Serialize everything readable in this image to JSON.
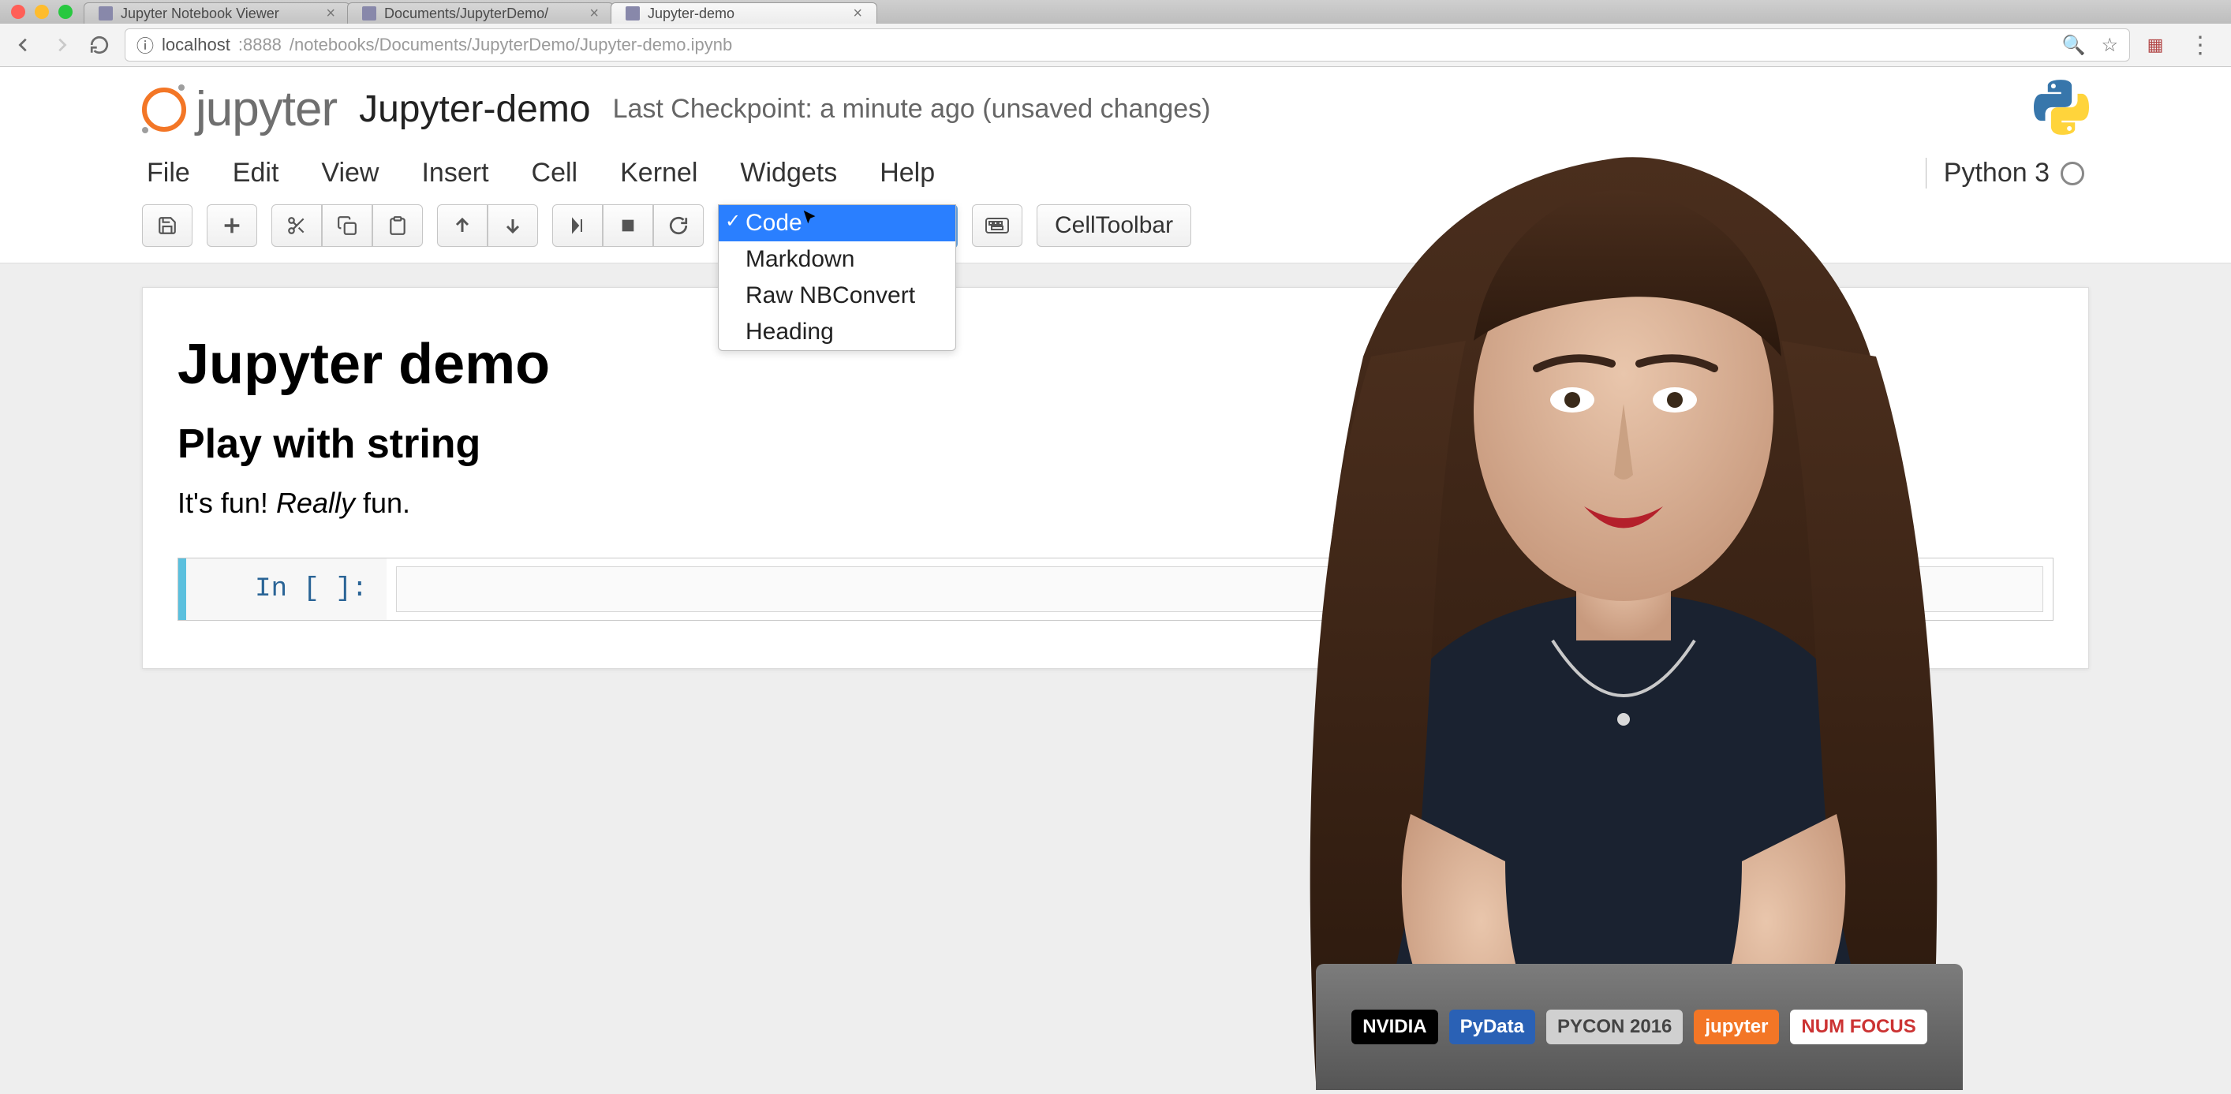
{
  "browser": {
    "tabs": [
      {
        "label": "Jupyter Notebook Viewer"
      },
      {
        "label": "Documents/JupyterDemo/"
      },
      {
        "label": "Jupyter-demo"
      }
    ],
    "url_host": "localhost",
    "url_port": ":8888",
    "url_path": "/notebooks/Documents/JupyterDemo/Jupyter-demo.ipynb"
  },
  "header": {
    "logo_text": "jupyter",
    "notebook_name": "Jupyter-demo",
    "checkpoint": "Last Checkpoint: a minute ago (unsaved changes)"
  },
  "menu": {
    "items": [
      "File",
      "Edit",
      "View",
      "Insert",
      "Cell",
      "Kernel",
      "Widgets",
      "Help"
    ],
    "kernel": "Python 3"
  },
  "toolbar": {
    "celltype_options": [
      "Code",
      "Markdown",
      "Raw NBConvert",
      "Heading"
    ],
    "celltype_selected": "Code",
    "celltoolbar_label": "CellToolbar"
  },
  "notebook": {
    "h1": "Jupyter demo",
    "h2": "Play with string",
    "p_a": "It's fun! ",
    "p_em": "Really",
    "p_b": " fun.",
    "prompt": "In [ ]:"
  },
  "stickers": [
    "NVIDIA",
    "PyData",
    "PYCON 2016",
    "jupyter",
    "NUM FOCUS"
  ]
}
